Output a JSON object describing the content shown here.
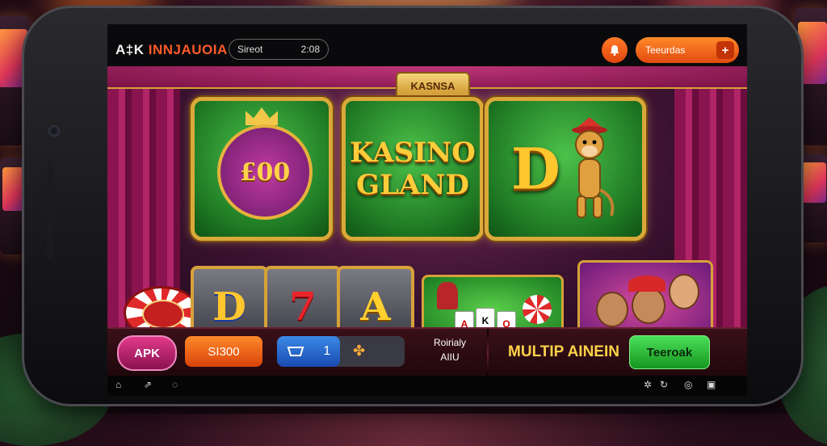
{
  "app": {
    "brand_part1": "A‡K",
    "brand_part2": "INNJAUOIA"
  },
  "statusbar": {
    "search_label": "Sireot",
    "search_value": "2:08",
    "notification_icon": "bell-icon",
    "action_button_label": "Teeurdas"
  },
  "stage": {
    "sign_text": "KASNSA",
    "tiles": [
      {
        "name": "coin-emblem",
        "text": "£00"
      },
      {
        "name": "kasino-gland",
        "text_line1": "KASINO",
        "text_line2": "GLAND"
      },
      {
        "name": "monkey-d",
        "text": "D"
      }
    ],
    "reels": [
      "D",
      "7",
      "A"
    ]
  },
  "bottombar": {
    "apk_label": "APK",
    "amount_label": "SI300",
    "counter_value": "1",
    "counter_icon": "clover-icon",
    "info_line1": "Roirialy",
    "info_line2": "AIIU",
    "multi_label": "MULTIP AINEIN",
    "green_button_label": "Teeroak"
  },
  "navbar": {
    "items": [
      "home-icon",
      "share-icon",
      "message-icon",
      "settings-icon",
      "refresh-icon",
      "record-icon",
      "tabs-icon"
    ]
  },
  "colors": {
    "accent_orange": "#ff6a1a",
    "felt_green": "#2a9a2e",
    "gold": "#d9a93a",
    "curtain_magenta": "#a01e5e"
  }
}
